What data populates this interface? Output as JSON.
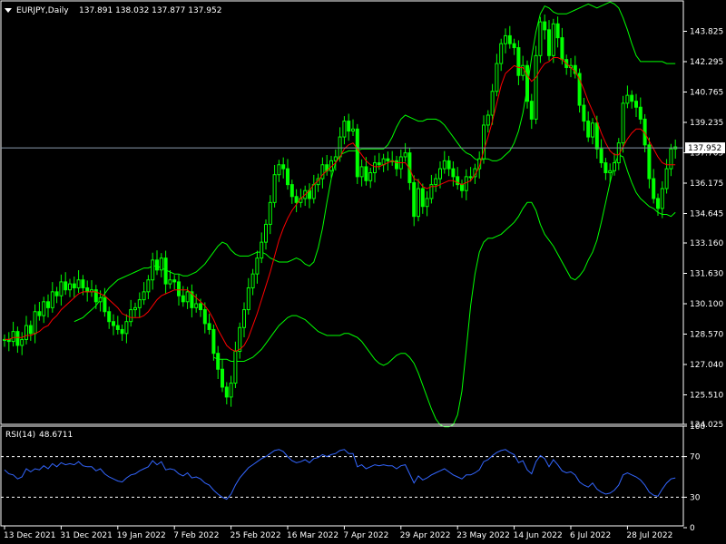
{
  "colors": {
    "background": "#000000",
    "frame": "#ffffff",
    "candle_up": "#00ff00",
    "candle_down": "#00ff00",
    "bollinger": "#00ff00",
    "moving_average": "#ff0000",
    "bid_line": "#8899aa",
    "rsi_line": "#3366ff",
    "rsi_levels": "#ffffff",
    "price_label_bg": "#ffffff",
    "price_label_text": "#000000"
  },
  "header": {
    "symbol": "EURJPY,Daily",
    "ohlc": "137.891 138.032 137.877 137.952",
    "menu_icon": "triangle-down-icon"
  },
  "rsi_header": {
    "label": "RSI(14)",
    "value": "48.6711"
  },
  "chart_data": [
    {
      "type": "candlestick",
      "ylim": [
        124.025,
        145.355
      ],
      "y_ticks": [
        "143.825",
        "142.295",
        "140.765",
        "139.235",
        "137.705",
        "136.175",
        "134.645",
        "133.160",
        "131.630",
        "130.100",
        "128.570",
        "127.040",
        "125.510",
        "124.025"
      ],
      "current_price": "137.952",
      "x_ticks": [
        "13 Dec 2021",
        "31 Dec 2021",
        "19 Jan 2022",
        "7 Feb 2022",
        "25 Feb 2022",
        "16 Mar 2022",
        "7 Apr 2022",
        "29 Apr 2022",
        "23 May 2022",
        "14 Jun 2022",
        "6 Jul 2022",
        "28 Jul 2022"
      ],
      "x_tick_bar_index": [
        0,
        13,
        26,
        39,
        52,
        65,
        78,
        91,
        104,
        117,
        130,
        143
      ],
      "series": [
        {
          "name": "Price",
          "kind": "candles",
          "close": [
            128.3,
            128.2,
            128.7,
            128.0,
            128.3,
            129.0,
            128.6,
            129.7,
            129.5,
            130.2,
            129.9,
            130.7,
            130.5,
            131.2,
            130.8,
            131.1,
            130.9,
            131.3,
            130.9,
            130.7,
            130.8,
            130.2,
            130.4,
            129.7,
            129.2,
            129.0,
            128.8,
            128.6,
            129.2,
            129.8,
            129.9,
            130.3,
            130.7,
            131.3,
            132.3,
            131.8,
            132.4,
            131.1,
            131.3,
            131.2,
            130.5,
            130.2,
            130.7,
            129.9,
            130.1,
            129.8,
            129.1,
            128.8,
            127.6,
            126.8,
            125.9,
            125.4,
            126.1,
            127.7,
            128.9,
            129.8,
            130.9,
            131.6,
            132.4,
            133.2,
            134.1,
            135.2,
            136.6,
            137.1,
            136.9,
            136.1,
            135.5,
            135.2,
            135.4,
            135.8,
            135.4,
            136.1,
            136.4,
            137.1,
            136.8,
            137.3,
            137.5,
            138.5,
            139.3,
            138.8,
            138.9,
            136.5,
            137.0,
            136.3,
            136.7,
            137.2,
            137.1,
            137.4,
            137.3,
            137.3,
            136.9,
            137.5,
            137.7,
            136.2,
            134.5,
            135.9,
            135.0,
            135.4,
            136.1,
            136.4,
            136.9,
            137.3,
            136.9,
            136.5,
            136.1,
            135.8,
            136.5,
            136.5,
            136.9,
            137.4,
            139.1,
            139.6,
            140.8,
            142.2,
            143.2,
            143.6,
            143.2,
            143.0,
            141.6,
            142.1,
            140.3,
            139.4,
            142.6,
            144.3,
            143.9,
            142.6,
            144.2,
            143.5,
            142.4,
            142.0,
            142.1,
            141.7,
            140.1,
            139.3,
            138.5,
            139.2,
            137.9,
            137.2,
            136.7,
            136.8,
            137.2,
            138.2,
            140.2,
            140.6,
            140.3,
            140.0,
            139.4,
            138.1,
            136.4,
            135.4,
            134.9,
            135.9,
            136.9,
            137.9,
            138.0
          ],
          "color": "#00ff00"
        },
        {
          "name": "Moving Average",
          "kind": "line",
          "values": [
            128.3,
            128.3,
            128.4,
            128.4,
            128.4,
            128.5,
            128.5,
            128.6,
            128.7,
            128.9,
            129.0,
            129.3,
            129.5,
            129.8,
            130.0,
            130.2,
            130.4,
            130.6,
            130.7,
            130.7,
            130.7,
            130.7,
            130.6,
            130.5,
            130.3,
            130.1,
            129.9,
            129.6,
            129.5,
            129.4,
            129.4,
            129.4,
            129.5,
            129.7,
            130.0,
            130.3,
            130.5,
            130.6,
            130.7,
            130.8,
            130.8,
            130.8,
            130.8,
            130.6,
            130.4,
            130.2,
            130.0,
            129.7,
            129.3,
            128.8,
            128.4,
            128.0,
            127.8,
            127.7,
            127.8,
            128.0,
            128.4,
            129.0,
            129.6,
            130.3,
            131.0,
            131.7,
            132.5,
            133.3,
            133.9,
            134.4,
            134.8,
            135.1,
            135.4,
            135.6,
            135.8,
            136.1,
            136.3,
            136.6,
            136.8,
            137.0,
            137.2,
            137.5,
            137.9,
            138.1,
            138.2,
            137.9,
            137.6,
            137.3,
            137.1,
            137.0,
            137.0,
            137.1,
            137.2,
            137.3,
            137.2,
            137.2,
            137.2,
            136.9,
            136.4,
            136.3,
            136.0,
            135.9,
            136.0,
            136.0,
            136.1,
            136.2,
            136.3,
            136.3,
            136.2,
            136.1,
            136.2,
            136.3,
            136.6,
            137.0,
            137.8,
            138.5,
            139.3,
            140.2,
            141.1,
            141.7,
            141.9,
            142.1,
            142.0,
            142.0,
            141.6,
            141.3,
            141.5,
            141.9,
            142.2,
            142.3,
            142.5,
            142.5,
            142.4,
            142.2,
            142.0,
            141.8,
            141.4,
            140.9,
            140.3,
            139.8,
            139.3,
            138.7,
            138.2,
            137.8,
            137.6,
            137.6,
            138.0,
            138.4,
            138.7,
            138.9,
            138.9,
            138.7,
            138.3,
            137.9,
            137.5,
            137.2,
            137.1,
            137.1,
            137.1
          ],
          "color": "#ff0000"
        },
        {
          "name": "Bollinger Upper",
          "kind": "line",
          "values": [
            129.2,
            129.3,
            129.4,
            129.6,
            129.8,
            130.0,
            130.3,
            130.6,
            130.9,
            131.1,
            131.3,
            131.4,
            131.5,
            131.6,
            131.7,
            131.8,
            131.9,
            131.9,
            132.0,
            132.0,
            131.9,
            131.8,
            131.7,
            131.6,
            131.6,
            131.5,
            131.5,
            131.6,
            131.7,
            131.9,
            132.1,
            132.4,
            132.7,
            133.0,
            133.2,
            133.1,
            132.8,
            132.6,
            132.5,
            132.5,
            132.5,
            132.6,
            132.7,
            132.7,
            132.6,
            132.4,
            132.3,
            132.2,
            132.2,
            132.2,
            132.3,
            132.4,
            132.3,
            132.1,
            132.0,
            132.2,
            132.9,
            133.9,
            135.2,
            136.4,
            137.2,
            137.6,
            137.7,
            137.8,
            137.8,
            137.8,
            137.9,
            137.9,
            137.9,
            137.9,
            137.9,
            137.9,
            138.1,
            138.5,
            139.0,
            139.4,
            139.6,
            139.5,
            139.4,
            139.3,
            139.3,
            139.4,
            139.4,
            139.4,
            139.3,
            139.1,
            138.8,
            138.5,
            138.2,
            137.9,
            137.7,
            137.6,
            137.4,
            137.3,
            137.4,
            137.4,
            137.3,
            137.3,
            137.4,
            137.6,
            137.8,
            138.2,
            138.8,
            139.7,
            141.0,
            142.5,
            143.8,
            144.7,
            145.1,
            145.0,
            144.8,
            144.7,
            144.7,
            144.7,
            144.8,
            144.9,
            145.0,
            145.1,
            145.2,
            145.1,
            145.0,
            145.1,
            145.2,
            145.3,
            145.2,
            145.0,
            144.5,
            143.9,
            143.2,
            142.6,
            142.3,
            142.3,
            142.3,
            142.3,
            142.3,
            142.3,
            142.2,
            142.2,
            142.2
          ],
          "color": "#00ff00"
        },
        {
          "name": "Bollinger Lower",
          "kind": "line",
          "values": [
            127.4,
            127.3,
            127.3,
            127.3,
            127.2,
            127.2,
            127.2,
            127.2,
            127.3,
            127.4,
            127.6,
            127.8,
            128.1,
            128.4,
            128.7,
            129.0,
            129.2,
            129.4,
            129.5,
            129.5,
            129.4,
            129.3,
            129.1,
            128.9,
            128.7,
            128.6,
            128.5,
            128.5,
            128.5,
            128.5,
            128.6,
            128.6,
            128.5,
            128.4,
            128.2,
            127.9,
            127.6,
            127.3,
            127.1,
            127.0,
            127.1,
            127.3,
            127.5,
            127.6,
            127.6,
            127.4,
            127.1,
            126.6,
            126.0,
            125.4,
            124.8,
            124.3,
            124.0,
            123.9,
            123.9,
            124.0,
            124.5,
            125.7,
            127.8,
            130.0,
            131.6,
            132.7,
            133.2,
            133.4,
            133.4,
            133.5,
            133.6,
            133.8,
            134.0,
            134.2,
            134.5,
            134.9,
            135.2,
            135.2,
            134.8,
            134.1,
            133.6,
            133.3,
            133.0,
            132.6,
            132.2,
            131.8,
            131.4,
            131.3,
            131.5,
            131.8,
            132.3,
            132.7,
            133.3,
            134.2,
            135.2,
            136.2,
            137.1,
            137.6,
            137.5,
            136.8,
            136.2,
            135.7,
            135.4,
            135.2,
            135.0,
            134.9,
            134.7,
            134.6,
            134.6,
            134.5,
            134.7
          ],
          "color": "#00ff00"
        }
      ]
    },
    {
      "type": "line",
      "title": "RSI(14) 48.6711",
      "ylim": [
        0,
        100
      ],
      "y_ticks": [
        "100",
        "70",
        "30",
        "0"
      ],
      "levels": [
        70,
        30
      ],
      "series": [
        {
          "name": "RSI(14)",
          "values": [
            57,
            53,
            52,
            48,
            50,
            58,
            55,
            58,
            57,
            61,
            58,
            63,
            60,
            64,
            62,
            63,
            62,
            65,
            61,
            60,
            60,
            56,
            58,
            53,
            50,
            48,
            46,
            45,
            49,
            52,
            53,
            56,
            58,
            60,
            66,
            62,
            65,
            57,
            58,
            57,
            53,
            51,
            54,
            49,
            50,
            48,
            44,
            42,
            37,
            33,
            30,
            28,
            33,
            42,
            49,
            54,
            59,
            62,
            65,
            68,
            70,
            73,
            76,
            77,
            75,
            70,
            66,
            64,
            65,
            67,
            64,
            68,
            69,
            72,
            70,
            72,
            73,
            76,
            77,
            73,
            73,
            60,
            62,
            58,
            60,
            62,
            61,
            62,
            61,
            61,
            58,
            61,
            62,
            53,
            44,
            51,
            47,
            49,
            52,
            54,
            56,
            58,
            55,
            52,
            50,
            48,
            52,
            52,
            54,
            57,
            65,
            67,
            71,
            74,
            76,
            77,
            74,
            72,
            64,
            66,
            57,
            53,
            65,
            71,
            68,
            60,
            67,
            62,
            56,
            54,
            55,
            52,
            45,
            42,
            40,
            44,
            38,
            35,
            33,
            34,
            37,
            42,
            52,
            54,
            52,
            50,
            47,
            42,
            35,
            32,
            31,
            38,
            44,
            48,
            49
          ],
          "color": "#3366ff"
        }
      ]
    }
  ]
}
